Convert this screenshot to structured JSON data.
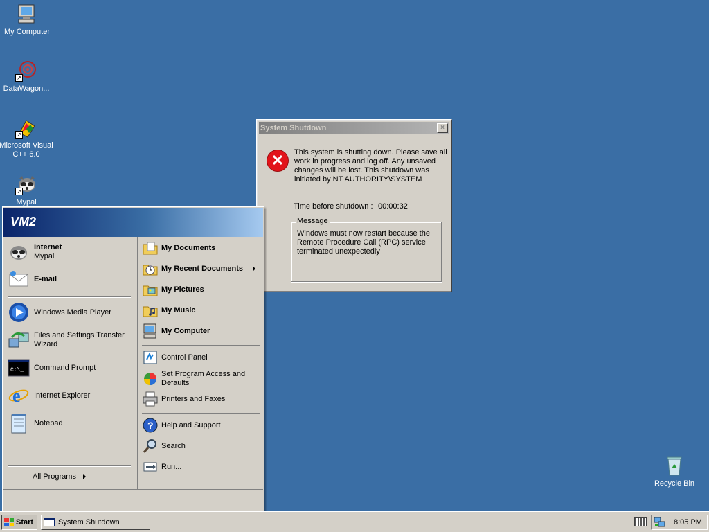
{
  "desktop": {
    "icons": [
      {
        "label": "My Computer",
        "icon": "my-computer-icon"
      },
      {
        "label": "DataWagon...",
        "icon": "datawagon-icon"
      },
      {
        "label": "Microsoft Visual C++ 6.0",
        "icon": "visual-cpp-icon"
      },
      {
        "label": "Mypal",
        "icon": "mypal-icon"
      },
      {
        "label": "Recycle Bin",
        "icon": "recycle-bin-icon"
      }
    ]
  },
  "dialog": {
    "title": "System Shutdown",
    "close_glyph": "×",
    "message": "This system is shutting down. Please save all work in progress and log off. Any unsaved changes will be lost. This shutdown was initiated by NT AUTHORITY\\SYSTEM",
    "time_label": "Time before shutdown :",
    "time_value": "00:00:32",
    "group_label": "Message",
    "group_text": "Windows must now restart because the Remote Procedure Call (RPC) service terminated unexpectedly"
  },
  "start_menu": {
    "user": "VM2",
    "left_items": [
      {
        "label": "Internet",
        "sub": "Mypal",
        "icon": "mypal-icon",
        "bold": true
      },
      {
        "label": "E-mail",
        "icon": "email-icon",
        "bold": true
      },
      {
        "label": "Windows Media Player",
        "icon": "media-player-icon"
      },
      {
        "label": "Files and Settings Transfer Wizard",
        "icon": "transfer-wizard-icon"
      },
      {
        "label": "Command Prompt",
        "icon": "command-prompt-icon"
      },
      {
        "label": "Internet Explorer",
        "icon": "internet-explorer-icon"
      },
      {
        "label": "Notepad",
        "icon": "notepad-icon"
      }
    ],
    "all_programs": "All Programs",
    "right_items": [
      {
        "label": "My Documents",
        "icon": "my-documents-icon"
      },
      {
        "label": "My Recent Documents",
        "icon": "recent-documents-icon"
      },
      {
        "label": "My Pictures",
        "icon": "my-pictures-icon"
      },
      {
        "label": "My Music",
        "icon": "my-music-icon"
      },
      {
        "label": "My Computer",
        "icon": "my-computer-icon"
      },
      {
        "label": "Control Panel",
        "icon": "control-panel-icon"
      },
      {
        "label": "Set Program Access and Defaults",
        "icon": "program-access-icon"
      },
      {
        "label": "Printers and Faxes",
        "icon": "printers-icon"
      },
      {
        "label": "Help and Support",
        "icon": "help-icon"
      },
      {
        "label": "Search",
        "icon": "search-icon"
      },
      {
        "label": "Run...",
        "icon": "run-icon"
      }
    ]
  },
  "taskbar": {
    "start_label": "Start",
    "task_label": "System Shutdown",
    "clock": "8:05 PM"
  }
}
